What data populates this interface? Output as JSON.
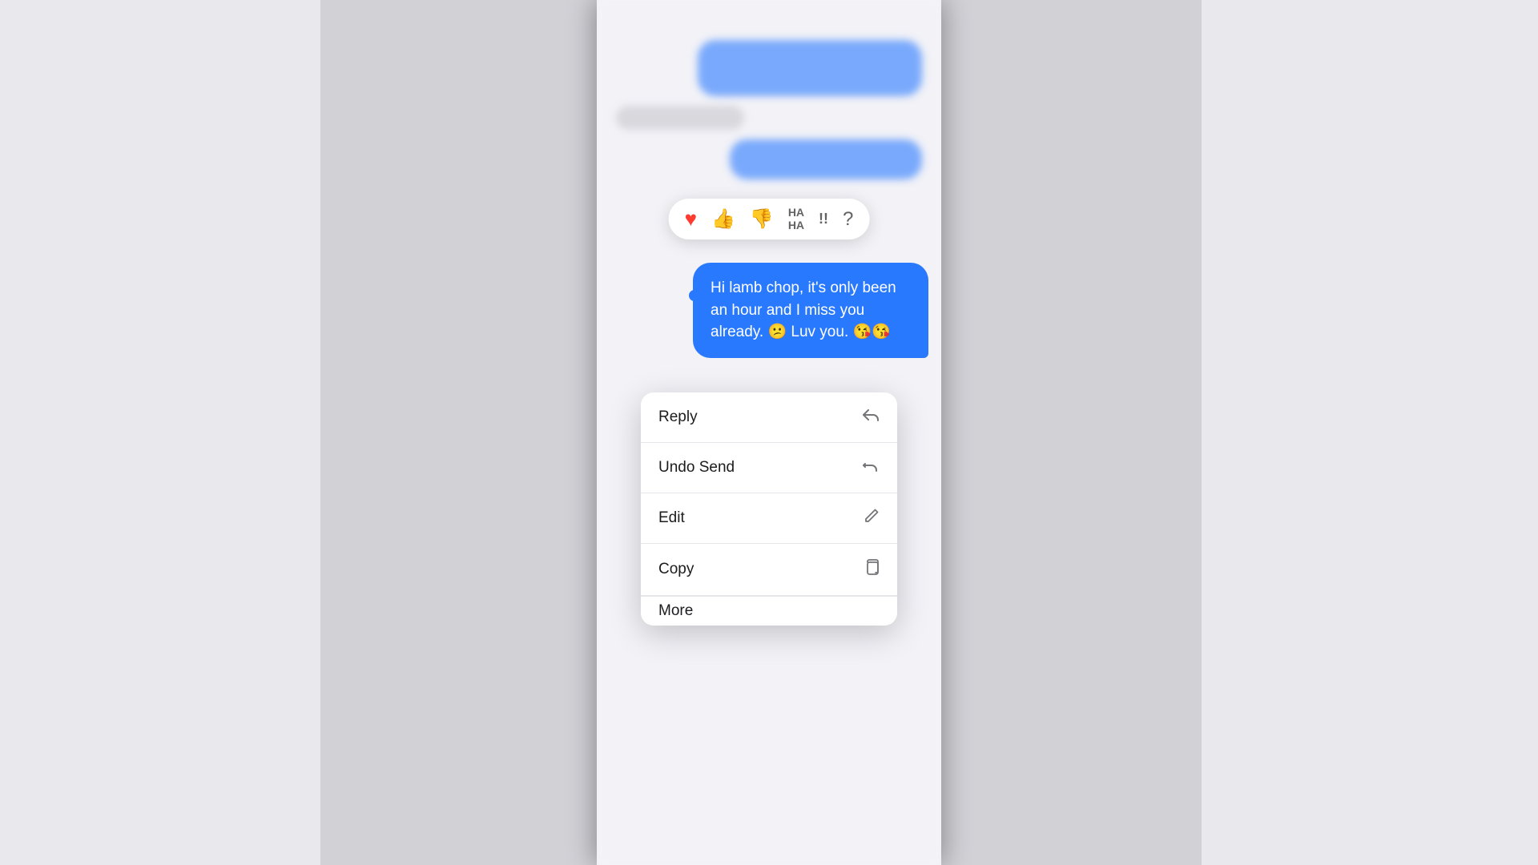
{
  "scene": {
    "bg_color": "#d1d1d6"
  },
  "phone": {
    "background": "#f2f2f7"
  },
  "message": {
    "text": "Hi lamb chop, it's only been an hour and I miss you already. 😕 Luv you. 😘😘",
    "bubble_color": "#2979FF",
    "text_color": "#ffffff"
  },
  "reaction_bar": {
    "items": [
      {
        "id": "heart",
        "label": "❤️",
        "type": "heart"
      },
      {
        "id": "thumbup",
        "label": "👍",
        "type": "thumb-up"
      },
      {
        "id": "thumbdown",
        "label": "👎",
        "type": "thumb-down"
      },
      {
        "id": "haha",
        "label": "HAHA",
        "type": "haha"
      },
      {
        "id": "exclaim",
        "label": "!!",
        "type": "exclaim"
      },
      {
        "id": "question",
        "label": "?",
        "type": "question"
      }
    ]
  },
  "context_menu": {
    "items": [
      {
        "id": "reply",
        "label": "Reply",
        "icon": "↩"
      },
      {
        "id": "undo-send",
        "label": "Undo Send",
        "icon": "↩"
      },
      {
        "id": "edit",
        "label": "Edit",
        "icon": "✏"
      },
      {
        "id": "copy",
        "label": "Copy",
        "icon": "⎘"
      }
    ],
    "partial_item": {
      "label": "More",
      "icon": "•••"
    }
  }
}
